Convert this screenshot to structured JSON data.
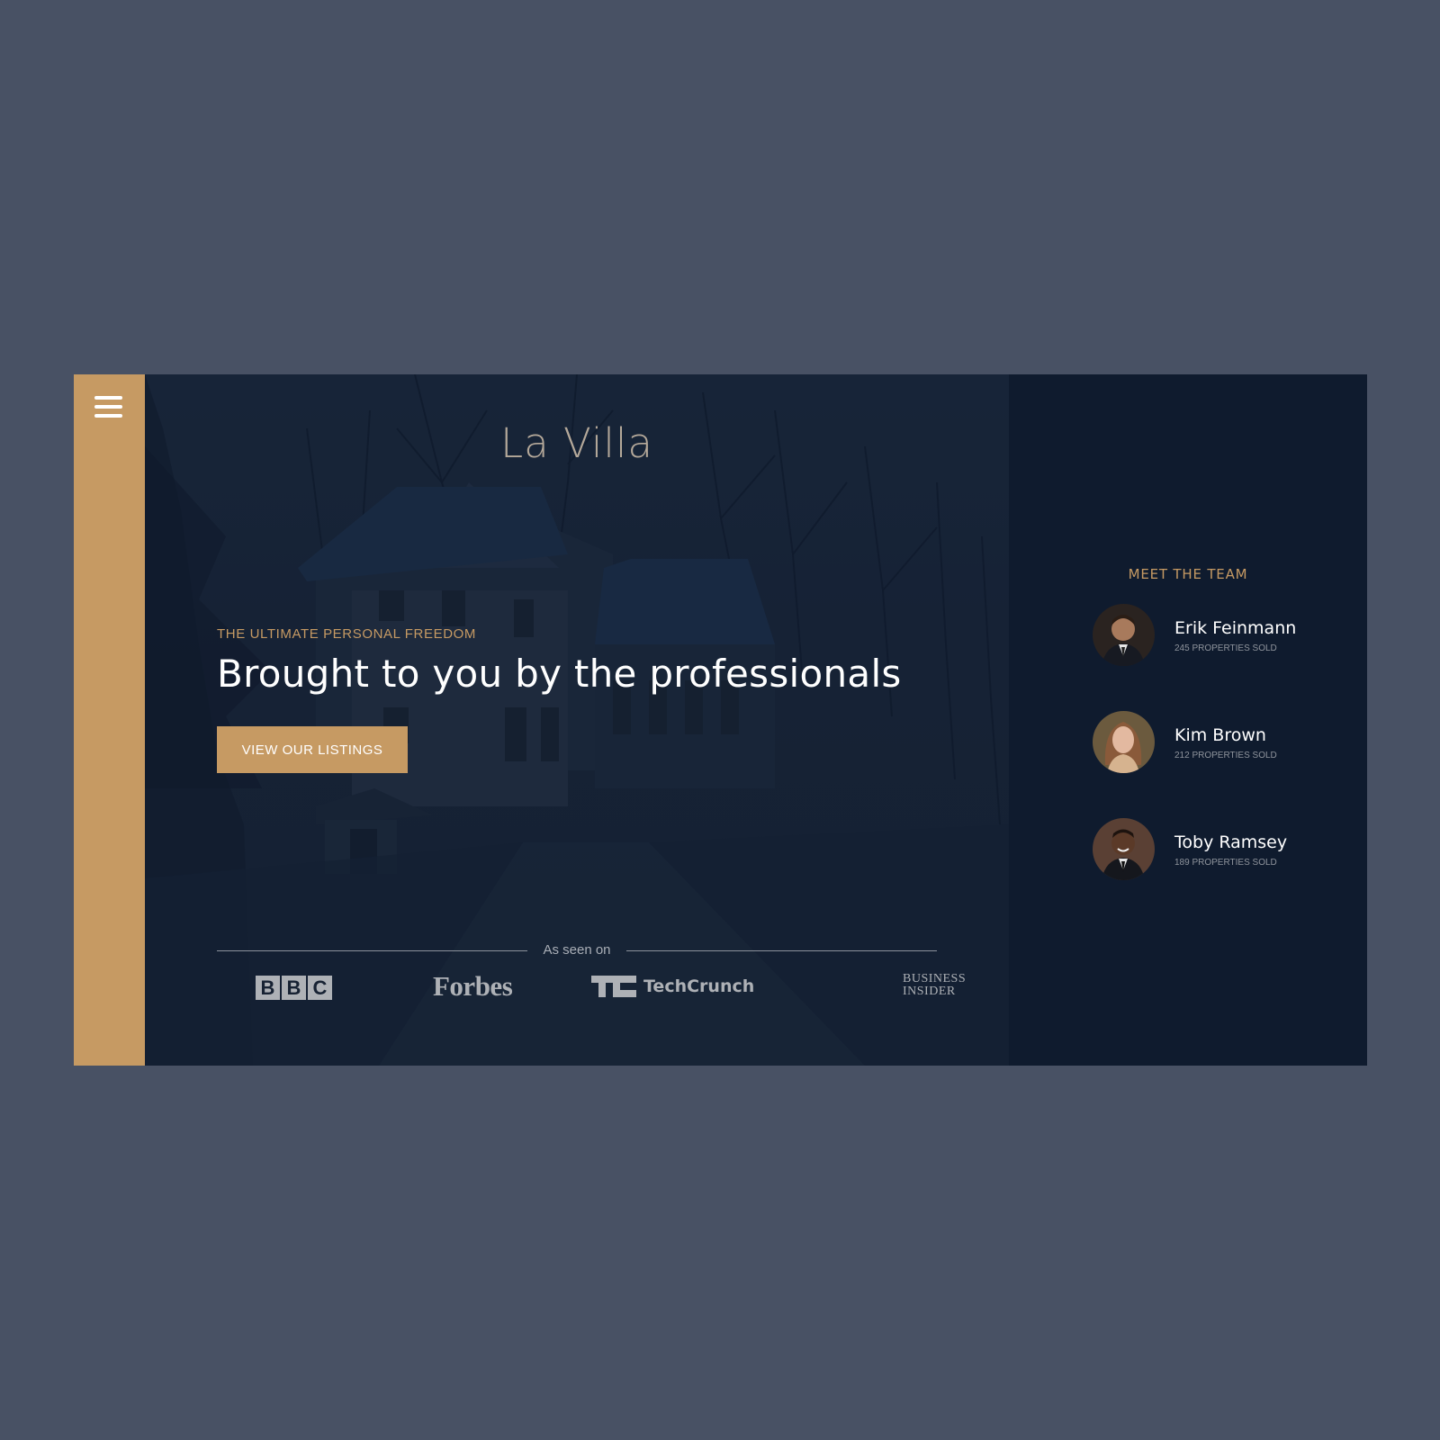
{
  "sidebar": {
    "menu_icon": "hamburger-icon"
  },
  "hero": {
    "brand": "La Villa",
    "eyebrow": "THE ULTIMATE PERSONAL FREEDOM",
    "headline": "Brought to you by the professionals",
    "cta_label": "VIEW OUR LISTINGS",
    "as_seen_on": "As seen on",
    "press_logos": {
      "bbc": [
        "B",
        "B",
        "C"
      ],
      "forbes": "Forbes",
      "techcrunch": "TechCrunch",
      "business_insider_line1": "BUSINESS",
      "business_insider_line2": "INSIDER"
    }
  },
  "team": {
    "title": "MEET THE TEAM",
    "members": [
      {
        "name": "Erik Feinmann",
        "sold": "245 PROPERTIES SOLD"
      },
      {
        "name": "Kim Brown",
        "sold": "212 PROPERTIES SOLD"
      },
      {
        "name": "Toby Ramsey",
        "sold": "189 PROPERTIES SOLD"
      }
    ]
  },
  "colors": {
    "page_bg": "#485164",
    "accent": "#c69a63",
    "panel": "#0f1b2e",
    "text_light": "#ffffff",
    "logo_gray": "#aeb1b6"
  }
}
